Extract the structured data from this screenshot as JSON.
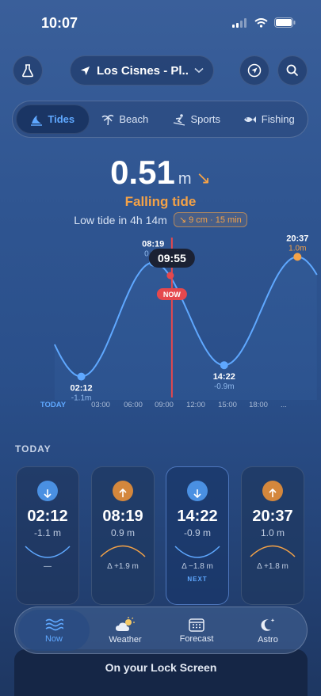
{
  "status": {
    "time": "10:07"
  },
  "header": {
    "location": "Los Cisnes - Pl..."
  },
  "tabs": [
    {
      "label": "Tides",
      "icon": "wave-icon",
      "active": true
    },
    {
      "label": "Beach",
      "icon": "palm-icon",
      "active": false
    },
    {
      "label": "Sports",
      "icon": "ski-icon",
      "active": false
    },
    {
      "label": "Fishing",
      "icon": "fish-icon",
      "active": false
    }
  ],
  "current": {
    "height": "0.51",
    "unit": "m",
    "trend_arrow": "↘",
    "state": "Falling tide",
    "next_text": "Low tide in 4h 14m",
    "change_badge": "↘ 9 cm · 15 min"
  },
  "chart_data": {
    "type": "line",
    "x_ticks": [
      "TODAY",
      "03:00",
      "06:00",
      "09:00",
      "12:00",
      "15:00",
      "18:00",
      "..."
    ],
    "cursor_time": "09:55",
    "now_label": "NOW",
    "extremes": [
      {
        "time": "02:12",
        "height": "-1.1m",
        "hours": 2.2,
        "value": -1.1,
        "type": "low"
      },
      {
        "time": "08:19",
        "height": "0.9m",
        "hours": 8.32,
        "value": 0.9,
        "type": "high"
      },
      {
        "time": "14:22",
        "height": "-0.9m",
        "hours": 14.37,
        "value": -0.9,
        "type": "low"
      },
      {
        "time": "20:37",
        "height": "1.0m",
        "hours": 20.62,
        "value": 1.0,
        "type": "high"
      }
    ],
    "now_hours": 9.92,
    "colors": {
      "line": "#5fa8ff",
      "high": "#f4a247",
      "now": "#e5484d"
    }
  },
  "today": {
    "title": "TODAY",
    "cards": [
      {
        "time": "02:12",
        "height": "-1.1 m",
        "diff": "—",
        "type": "low",
        "next": ""
      },
      {
        "time": "08:19",
        "height": "0.9 m",
        "diff": "Δ +1.9 m",
        "type": "high",
        "next": ""
      },
      {
        "time": "14:22",
        "height": "-0.9 m",
        "diff": "Δ −1.8 m",
        "type": "low",
        "next": "NEXT"
      },
      {
        "time": "20:37",
        "height": "1.0 m",
        "diff": "Δ +1.8 m",
        "type": "high",
        "next": ""
      }
    ]
  },
  "lock_banner": "On your Lock Screen",
  "nav": [
    {
      "label": "Now",
      "icon": "waves-icon",
      "active": true
    },
    {
      "label": "Weather",
      "icon": "cloud-sun-icon",
      "active": false
    },
    {
      "label": "Forecast",
      "icon": "calendar-icon",
      "active": false
    },
    {
      "label": "Astro",
      "icon": "moon-stars-icon",
      "active": false
    }
  ]
}
